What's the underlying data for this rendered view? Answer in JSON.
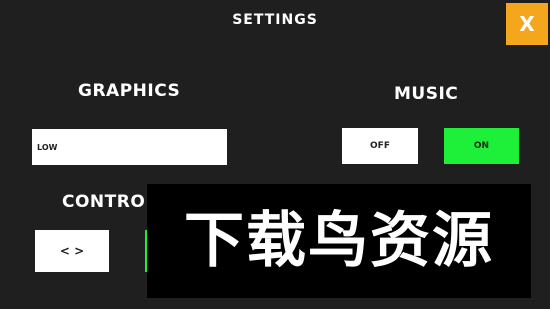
{
  "header": {
    "title": "SETTINGS",
    "close_label": "X"
  },
  "graphics": {
    "label": "GRAPHICS",
    "selected_value": "LOW"
  },
  "music": {
    "label": "MUSIC",
    "off_label": "OFF",
    "on_label": "ON"
  },
  "controls": {
    "label": "CONTRO",
    "button_label": "< >"
  },
  "watermark": {
    "text": "下载鸟资源"
  },
  "colors": {
    "background": "#1f1f1f",
    "accent_close": "#f4a61d",
    "active_green": "#1ef03a",
    "panel_white": "#ffffff",
    "watermark_bg": "#000000"
  }
}
